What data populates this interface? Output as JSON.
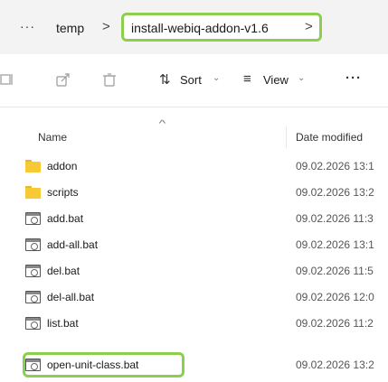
{
  "breadcrumb": {
    "more": "···",
    "items": [
      "temp",
      "install-webiq-addon-v1.6"
    ],
    "separator": ">",
    "current_chevron": ">"
  },
  "toolbar": {
    "sort_label": "Sort",
    "view_label": "View",
    "more_label": "···",
    "icons": [
      "rename-icon",
      "share-icon",
      "delete-icon",
      "sort-icon",
      "view-icon"
    ]
  },
  "columns": {
    "name": "Name",
    "date_modified": "Date modified",
    "sorted_by": "name"
  },
  "files": [
    {
      "name": "addon",
      "date": "09.02.2026 13:1",
      "type": "folder"
    },
    {
      "name": "scripts",
      "date": "09.02.2026 13:2",
      "type": "folder"
    },
    {
      "name": "add.bat",
      "date": "09.02.2026 11:3",
      "type": "bat"
    },
    {
      "name": "add-all.bat",
      "date": "09.02.2026 13:1",
      "type": "bat"
    },
    {
      "name": "del.bat",
      "date": "09.02.2026 11:5",
      "type": "bat"
    },
    {
      "name": "del-all.bat",
      "date": "09.02.2026 12:0",
      "type": "bat"
    },
    {
      "name": "list.bat",
      "date": "09.02.2026 11:2",
      "type": "bat"
    },
    {
      "name": "open-unit-class.bat",
      "date": "09.02.2026 13:2",
      "type": "bat"
    }
  ],
  "colors": {
    "highlight": "#8ccf4d",
    "folder": "#f7c934",
    "breadcrumb_bg": "#f3f3f3"
  }
}
